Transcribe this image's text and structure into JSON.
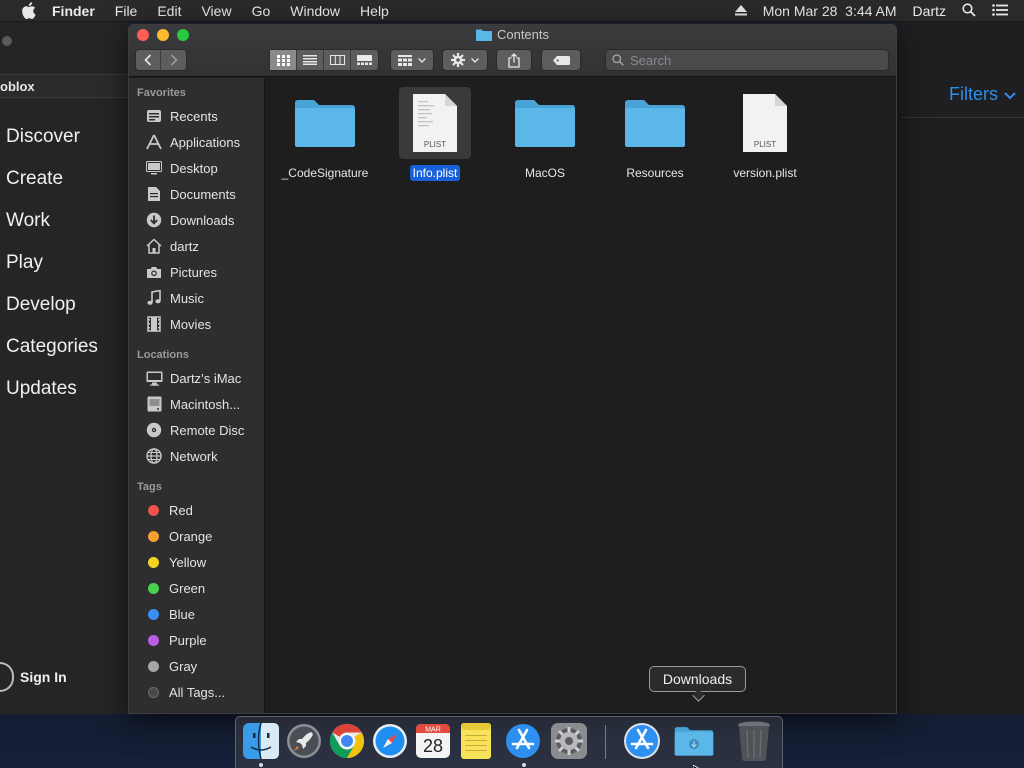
{
  "menubar": {
    "app_name": "Finder",
    "menus": [
      "File",
      "Edit",
      "View",
      "Go",
      "Window",
      "Help"
    ],
    "datetime": "Mon Mar 28  3:44 AM",
    "user": "Dartz"
  },
  "background_app": {
    "title": "oblox",
    "nav": [
      "Discover",
      "Create",
      "Work",
      "Play",
      "Develop",
      "Categories",
      "Updates"
    ],
    "sign_in": "Sign In",
    "filters": "Filters"
  },
  "finder": {
    "window_title": "Contents",
    "search_placeholder": "Search",
    "sidebar": {
      "favorites_heading": "Favorites",
      "favorites": [
        {
          "label": "Recents",
          "icon": "recents-icon"
        },
        {
          "label": "Applications",
          "icon": "applications-icon"
        },
        {
          "label": "Desktop",
          "icon": "desktop-icon"
        },
        {
          "label": "Documents",
          "icon": "documents-icon"
        },
        {
          "label": "Downloads",
          "icon": "downloads-icon"
        },
        {
          "label": "dartz",
          "icon": "home-icon"
        },
        {
          "label": "Pictures",
          "icon": "pictures-icon"
        },
        {
          "label": "Music",
          "icon": "music-icon"
        },
        {
          "label": "Movies",
          "icon": "movies-icon"
        }
      ],
      "locations_heading": "Locations",
      "locations": [
        {
          "label": "Dartz’s iMac",
          "icon": "imac-icon"
        },
        {
          "label": "Macintosh...",
          "icon": "harddisk-icon"
        },
        {
          "label": "Remote Disc",
          "icon": "remote-disc-icon"
        },
        {
          "label": "Network",
          "icon": "network-icon"
        }
      ],
      "tags_heading": "Tags",
      "tags": [
        {
          "label": "Red",
          "color": "#f0524c"
        },
        {
          "label": "Orange",
          "color": "#f5a030"
        },
        {
          "label": "Yellow",
          "color": "#f4d41e"
        },
        {
          "label": "Green",
          "color": "#48d14f"
        },
        {
          "label": "Blue",
          "color": "#3a8ff5"
        },
        {
          "label": "Purple",
          "color": "#bb5fe0"
        },
        {
          "label": "Gray",
          "color": "#a6a6a8"
        },
        {
          "label": "All Tags...",
          "color": "#4a4a4c"
        }
      ]
    },
    "files": [
      {
        "name": "_CodeSignature",
        "kind": "folder",
        "selected": false
      },
      {
        "name": "Info.plist",
        "kind": "plist",
        "selected": true,
        "badge": "PLIST"
      },
      {
        "name": "MacOS",
        "kind": "folder",
        "selected": false
      },
      {
        "name": "Resources",
        "kind": "folder",
        "selected": false
      },
      {
        "name": "version.plist",
        "kind": "plist",
        "selected": false,
        "badge": "PLIST"
      }
    ]
  },
  "dock": {
    "tooltip": "Downloads",
    "calendar_month": "MAR",
    "calendar_day": "28",
    "apps": [
      "finder-icon",
      "launchpad-icon",
      "chrome-icon",
      "safari-icon",
      "calendar-icon",
      "notes-icon",
      "app-store-icon",
      "system-preferences-icon",
      "app-store-download-icon",
      "downloads-stack-icon",
      "trash-icon"
    ]
  },
  "colors": {
    "accent_blue": "#2f8fe8",
    "selection_blue": "#1861d8",
    "folder_blue": "#5bb7e8"
  }
}
